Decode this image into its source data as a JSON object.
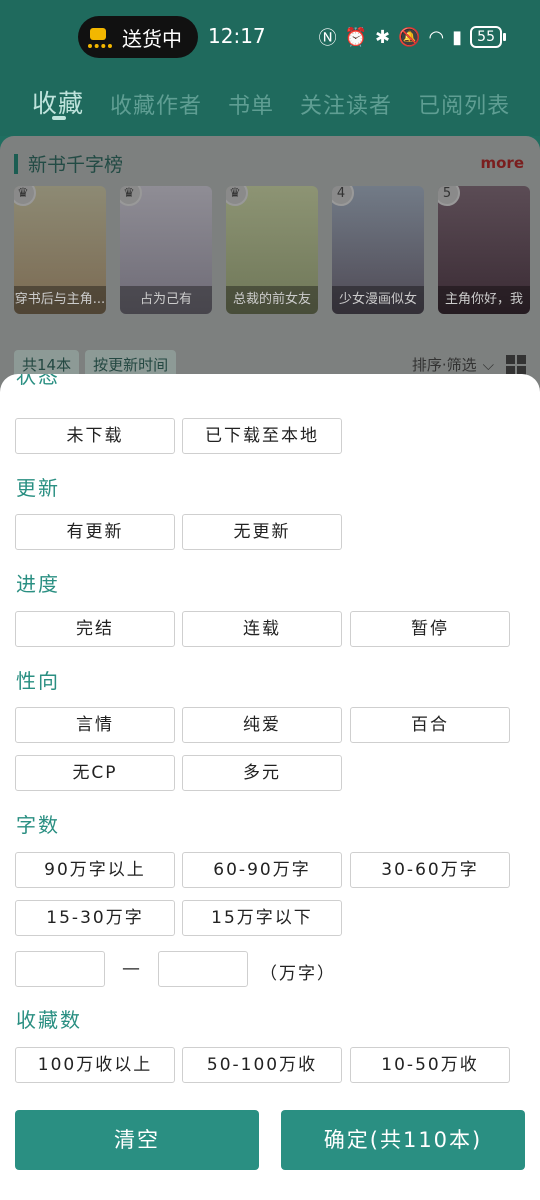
{
  "status_bar": {
    "delivery_label": "送货中",
    "time": "12:17",
    "battery": "55"
  },
  "top_tabs": [
    "收藏",
    "收藏作者",
    "书单",
    "关注读者",
    "已阅列表"
  ],
  "ranking": {
    "title": "新书千字榜",
    "more_label": "more",
    "books": [
      {
        "rank": "",
        "caption": "穿书后与主角..."
      },
      {
        "rank": "",
        "caption": "占为己有"
      },
      {
        "rank": "",
        "caption": "总裁的前女友"
      },
      {
        "rank": "4",
        "caption": "少女漫画似女"
      },
      {
        "rank": "5",
        "caption": "主角你好，我"
      }
    ]
  },
  "list_info": {
    "count": "共14本",
    "sort_tag": "按更新时间",
    "sort_filter": "排序·筛选"
  },
  "filter_sheet": {
    "partial_header": "状态",
    "status_options": [
      "未下载",
      "已下载至本地"
    ],
    "update_title": "更新",
    "update_options": [
      "有更新",
      "无更新"
    ],
    "progress_title": "进度",
    "progress_options": [
      "完结",
      "连载",
      "暂停"
    ],
    "orientation_title": "性向",
    "orientation_options": [
      "言情",
      "纯爱",
      "百合",
      "无CP",
      "多元"
    ],
    "wordcount_title": "字数",
    "wordcount_options": [
      "90万字以上",
      "60-90万字",
      "30-60万字",
      "15-30万字",
      "15万字以下"
    ],
    "range_dash": "—",
    "range_unit": "（万字）",
    "favorites_title": "收藏数",
    "favorites_options": [
      "100万收以上",
      "50-100万收",
      "10-50万收"
    ],
    "clear_label": "清空",
    "confirm_label": "确定(共110本)"
  }
}
